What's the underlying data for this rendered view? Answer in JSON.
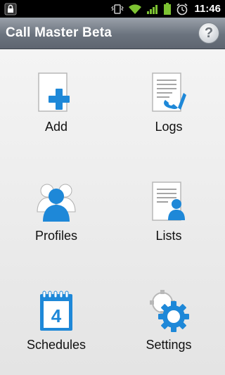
{
  "status": {
    "time": "11:46"
  },
  "header": {
    "title": "Call Master Beta",
    "help_symbol": "?"
  },
  "menu": [
    {
      "label": "Add",
      "icon": "add-document-icon"
    },
    {
      "label": "Logs",
      "icon": "call-log-icon"
    },
    {
      "label": "Profiles",
      "icon": "profiles-icon"
    },
    {
      "label": "Lists",
      "icon": "contact-list-icon"
    },
    {
      "label": "Schedules",
      "icon": "calendar-icon"
    },
    {
      "label": "Settings",
      "icon": "gear-icon"
    }
  ],
  "colors": {
    "accent_blue": "#1e88d8",
    "status_green": "#7dc332"
  }
}
